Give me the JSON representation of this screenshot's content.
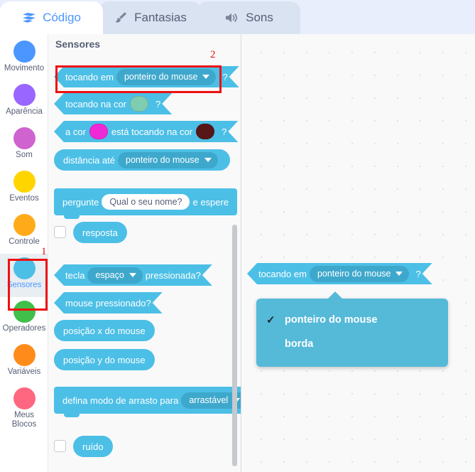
{
  "tabs": [
    {
      "label": "Código",
      "icon": "blocks-icon",
      "active": true
    },
    {
      "label": "Fantasias",
      "icon": "brush-icon",
      "active": false
    },
    {
      "label": "Sons",
      "icon": "speaker-icon",
      "active": false
    }
  ],
  "sidebar": {
    "items": [
      {
        "label": "Movimento",
        "color": "#4c97ff",
        "selected": false
      },
      {
        "label": "Aparência",
        "color": "#9966ff",
        "selected": false
      },
      {
        "label": "Som",
        "color": "#cf63cf",
        "selected": false
      },
      {
        "label": "Eventos",
        "color": "#ffd500",
        "selected": false
      },
      {
        "label": "Controle",
        "color": "#ffab19",
        "selected": false
      },
      {
        "label": "Sensores",
        "color": "#4cbfe6",
        "selected": true
      },
      {
        "label": "Operadores",
        "color": "#40bf4a",
        "selected": false
      },
      {
        "label": "Variáveis",
        "color": "#ff8c1a",
        "selected": false
      },
      {
        "label": "Meus Blocos",
        "color": "#ff6680",
        "selected": false
      }
    ]
  },
  "palette": {
    "header": "Sensores",
    "blocks": {
      "touching": {
        "pre": "tocando em",
        "value": "ponteiro do mouse",
        "post": "?"
      },
      "touching_color": {
        "pre": "tocando na cor",
        "swatch": "#7ecdb0",
        "post": "?"
      },
      "color_touching": {
        "pre": "a cor",
        "swatch1": "#f029d6",
        "mid": "está tocando na cor",
        "swatch2": "#571618",
        "post": "?"
      },
      "distance_to": {
        "pre": "distância até",
        "value": "ponteiro do mouse"
      },
      "ask_and_wait": {
        "pre": "pergunte",
        "value": "Qual o seu nome?",
        "post": "e espere"
      },
      "answer": {
        "label": "resposta",
        "checked": false
      },
      "key_pressed": {
        "pre": "tecla",
        "value": "espaço",
        "post": "pressionada?"
      },
      "mouse_down": {
        "label": "mouse pressionado?"
      },
      "mouse_x": {
        "label": "posição x do mouse"
      },
      "mouse_y": {
        "label": "posição y do mouse"
      },
      "drag_mode": {
        "pre": "defina modo de arrasto para",
        "value": "arrastável"
      },
      "loudness": {
        "label": "ruído",
        "checked": false
      }
    }
  },
  "workspace": {
    "block": {
      "pre": "tocando em",
      "value": "ponteiro do mouse",
      "post": "?"
    },
    "dropdown": {
      "options": [
        {
          "label": "ponteiro do mouse",
          "checked": true,
          "check_glyph": "✓"
        },
        {
          "label": "borda",
          "checked": false,
          "check_glyph": ""
        }
      ]
    }
  },
  "annotations": [
    {
      "id": "1",
      "label": "1"
    },
    {
      "id": "2",
      "label": "2"
    }
  ],
  "colors": {
    "accent": "#4c97ff",
    "sensing": "#4cbfe6",
    "annotation": "#ee1111"
  }
}
